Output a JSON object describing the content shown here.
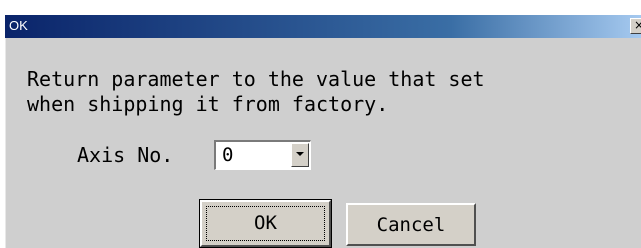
{
  "dialog": {
    "title": "OK",
    "close_label": "×",
    "message_line1": "Return parameter to the value that set",
    "message_line2": "when shipping it from factory.",
    "axis_label": "Axis No.",
    "axis_value": "0",
    "ok_label": "OK",
    "cancel_label": "Cancel"
  },
  "icons": {
    "close": "close-icon",
    "dropdown": "chevron-down-icon"
  },
  "colors": {
    "title_bar_start": "#0a246a",
    "title_bar_end": "#a6caf0",
    "dialog_background": "#cfcfcf"
  }
}
